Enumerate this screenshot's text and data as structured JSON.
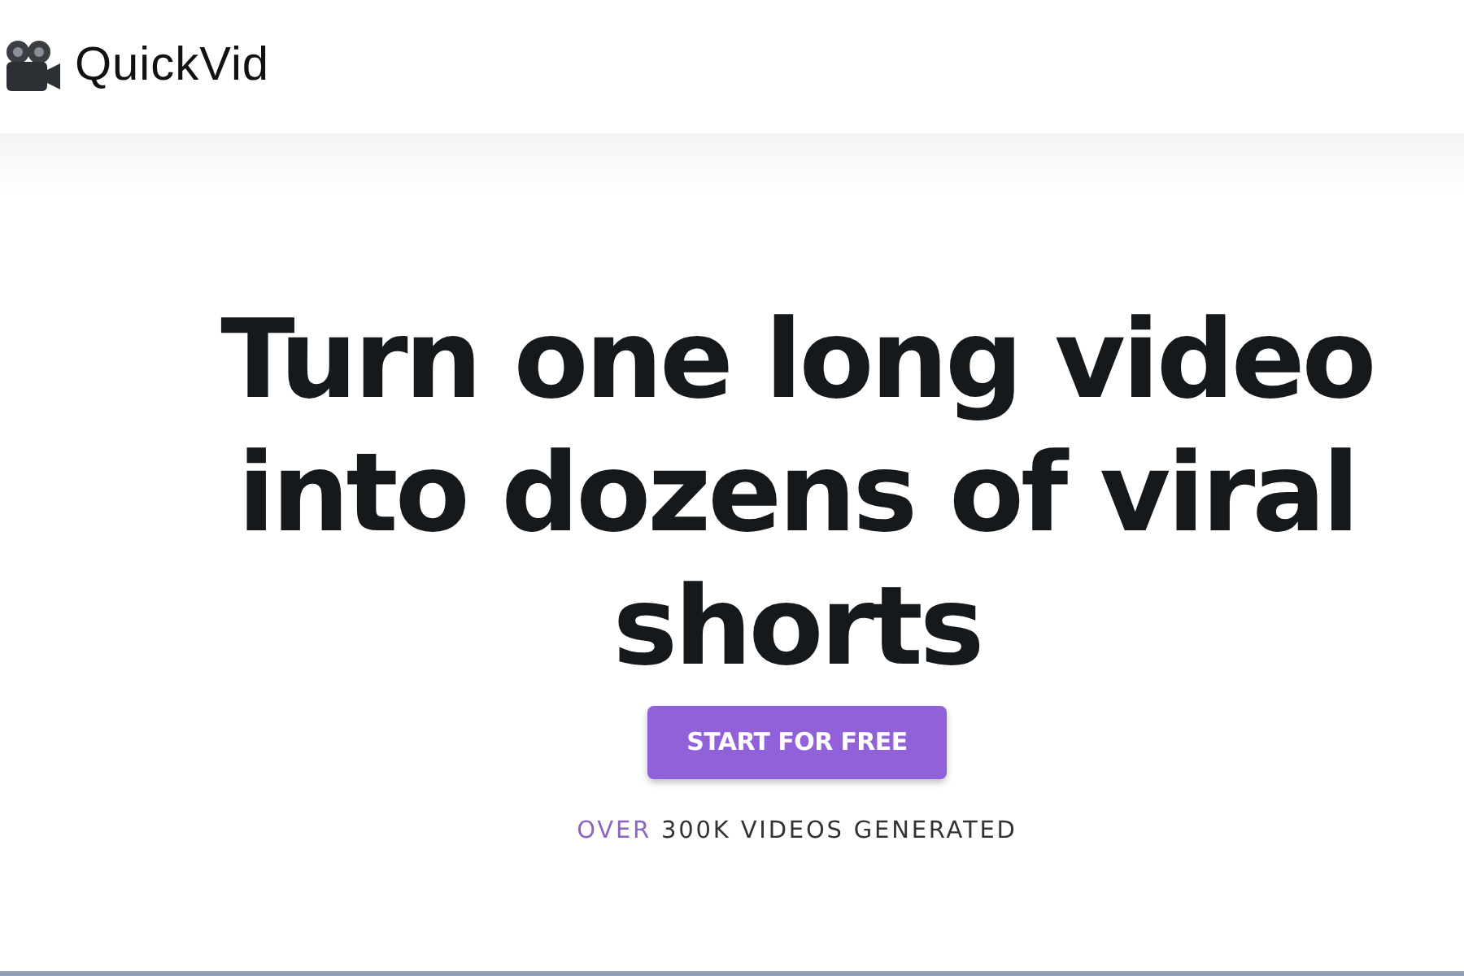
{
  "brand": {
    "name": "QuickVid"
  },
  "hero": {
    "headline": "Turn one long video into dozens of viral shorts",
    "cta": "START FOR FREE",
    "tagline": [
      {
        "text": "OVER",
        "accent": true
      },
      {
        "text": "300K VIDEOS GENERATED",
        "accent": false
      }
    ]
  }
}
